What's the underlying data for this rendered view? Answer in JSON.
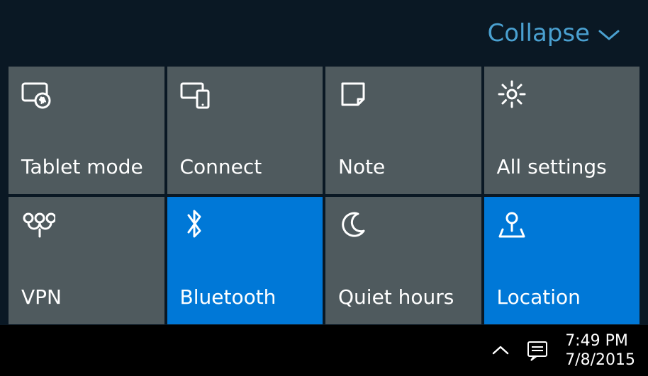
{
  "header": {
    "collapse_label": "Collapse"
  },
  "tiles": [
    {
      "label": "Tablet mode",
      "icon": "tablet-mode-icon",
      "active": false
    },
    {
      "label": "Connect",
      "icon": "connect-icon",
      "active": false
    },
    {
      "label": "Note",
      "icon": "note-icon",
      "active": false
    },
    {
      "label": "All settings",
      "icon": "settings-icon",
      "active": false
    },
    {
      "label": "VPN",
      "icon": "vpn-icon",
      "active": false
    },
    {
      "label": "Bluetooth",
      "icon": "bluetooth-icon",
      "active": true
    },
    {
      "label": "Quiet hours",
      "icon": "quiet-hours-icon",
      "active": false
    },
    {
      "label": "Location",
      "icon": "location-icon",
      "active": true
    }
  ],
  "taskbar": {
    "time": "7:49 PM",
    "date": "7/8/2015"
  }
}
